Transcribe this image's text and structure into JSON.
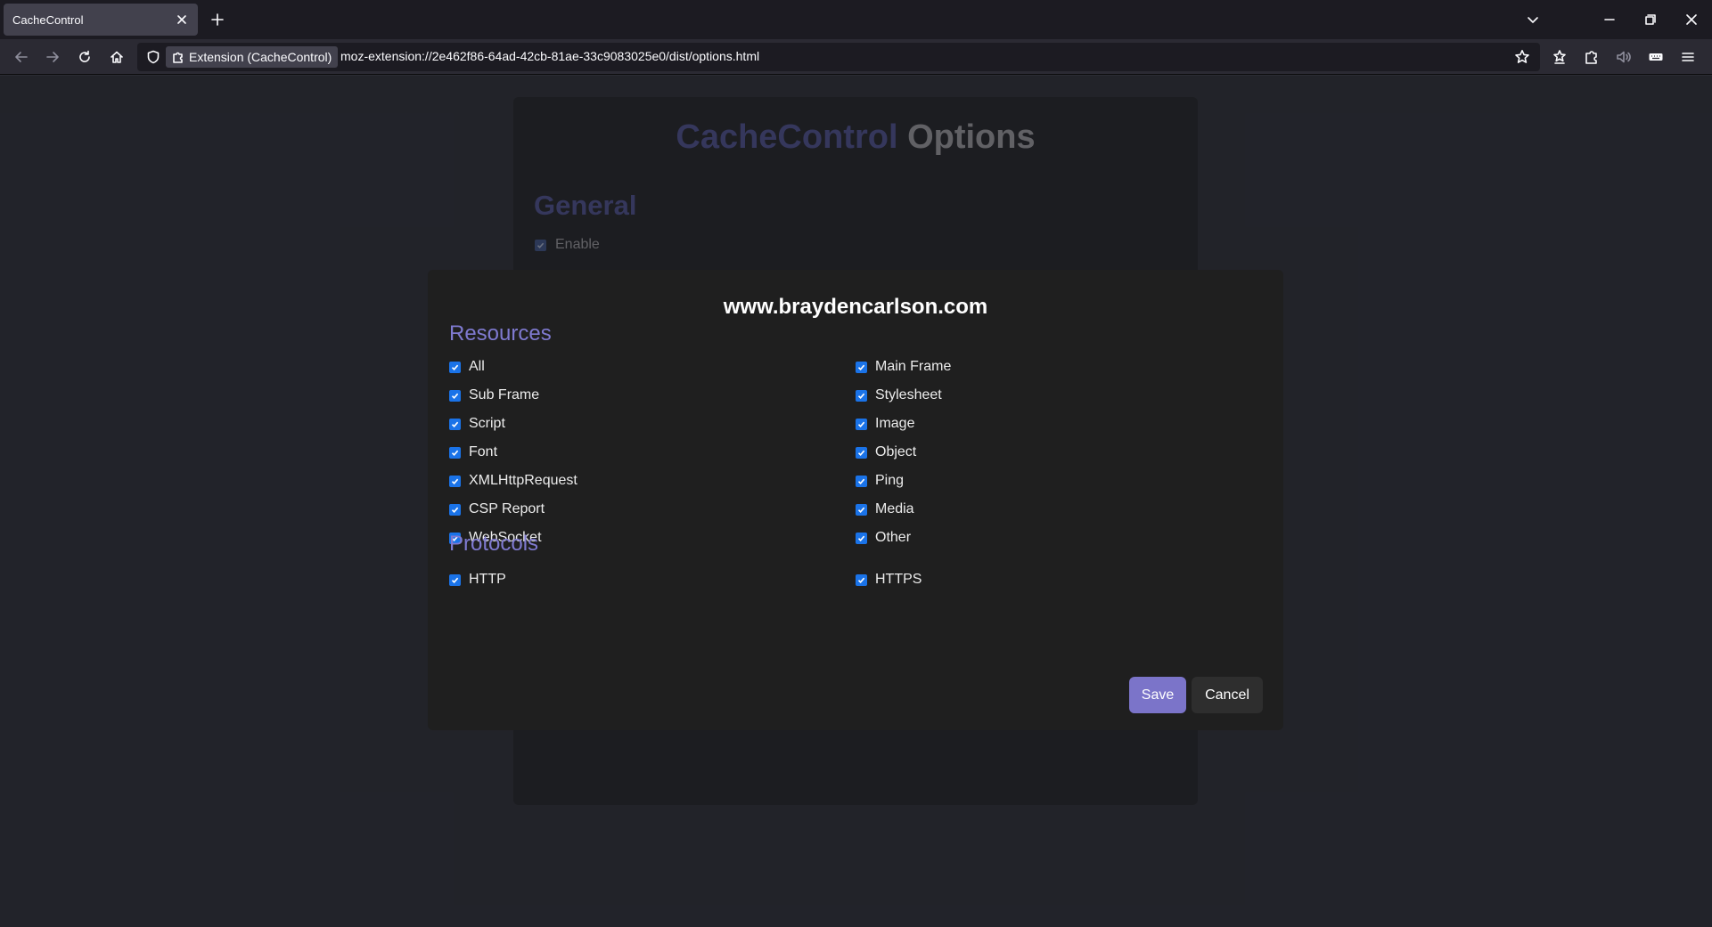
{
  "browser": {
    "tab_title": "CacheControl",
    "identity_label": "Extension (CacheControl)",
    "url": "moz-extension://2e462f86-64ad-42cb-81ae-33c9083025e0/dist/options.html"
  },
  "options_page": {
    "title_brand": "CacheControl",
    "title_rest": " Options",
    "general_heading": "General",
    "enable_label": "Enable",
    "enable_checked": true
  },
  "modal": {
    "site": "www.braydencarlson.com",
    "resources_heading": "Resources",
    "resources_left": [
      {
        "label": "All",
        "checked": true
      },
      {
        "label": "Sub Frame",
        "checked": true
      },
      {
        "label": "Script",
        "checked": true
      },
      {
        "label": "Font",
        "checked": true
      },
      {
        "label": "XMLHttpRequest",
        "checked": true
      },
      {
        "label": "CSP Report",
        "checked": true
      },
      {
        "label": "WebSocket",
        "checked": true
      }
    ],
    "resources_right": [
      {
        "label": "Main Frame",
        "checked": true
      },
      {
        "label": "Stylesheet",
        "checked": true
      },
      {
        "label": "Image",
        "checked": true
      },
      {
        "label": "Object",
        "checked": true
      },
      {
        "label": "Ping",
        "checked": true
      },
      {
        "label": "Media",
        "checked": true
      },
      {
        "label": "Other",
        "checked": true
      }
    ],
    "protocols_heading": "Protocols",
    "protocols": [
      {
        "label": "HTTP",
        "checked": true
      },
      {
        "label": "HTTPS",
        "checked": true
      }
    ],
    "save_label": "Save",
    "cancel_label": "Cancel"
  },
  "colors": {
    "accent": "#7b74c9",
    "heading": "#7f7ad0",
    "checkbox": "#1a73e8",
    "page_bg": "#2a2b33",
    "modal_bg": "#1f1f1f"
  }
}
